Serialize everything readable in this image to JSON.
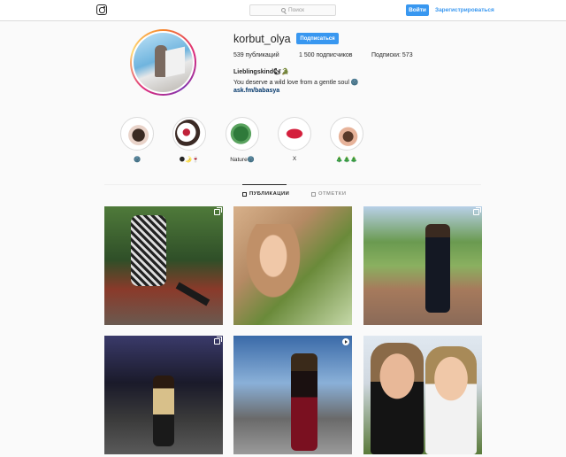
{
  "header": {
    "search_placeholder": "Поиск",
    "login_label": "Войти",
    "register_label": "Зарегистрироваться"
  },
  "profile": {
    "username": "korbut_olya",
    "follow_label": "Подписаться",
    "stats": {
      "posts": "539 публикаций",
      "followers": "1 500 подписчиков",
      "following": "Подписки: 573"
    },
    "bio_name": "Lieblingskind🐿🐊",
    "bio_text": "You deserve a wild love from a gentle soul 🌚",
    "bio_link": "ask.fm/babasya"
  },
  "highlights": [
    {
      "label": "🌚"
    },
    {
      "label": "🌑🌛🍷"
    },
    {
      "label": "Nature🌚"
    },
    {
      "label": "X"
    },
    {
      "label": "🎄🎄🎄"
    }
  ],
  "tabs": {
    "posts": "ПУБЛИКАЦИИ",
    "tagged": "ОТМЕТКИ"
  },
  "colors": {
    "accent": "#3897f0",
    "link": "#003569"
  },
  "icons": [
    "instagram-icon",
    "search-icon",
    "grid-icon",
    "tag-icon",
    "multi-post-icon",
    "video-icon"
  ]
}
